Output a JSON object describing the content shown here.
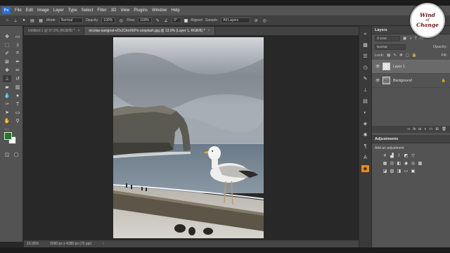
{
  "menubar": {
    "logo": "Ps",
    "items": [
      "File",
      "Edit",
      "Image",
      "Layer",
      "Type",
      "Select",
      "Filter",
      "3D",
      "View",
      "Plugins",
      "Window",
      "Help"
    ]
  },
  "options": {
    "mode_label": "Mode:",
    "mode_value": "Normal",
    "opacity_label": "Opacity:",
    "opacity_value": "100%",
    "flow_label": "Flow:",
    "flow_value": "100%",
    "angle_value": "0°",
    "aligned_label": "Aligned",
    "sample_label": "Sample:",
    "sample_value": "All Layers"
  },
  "tabs": [
    {
      "label": "Untitled-1 @ 97.6% (RGB/8) *",
      "close": "×"
    },
    {
      "label": "nicolas-savignat-vOxJCtmXKPo-unsplash.jpg @ 13.9% (Layer 1, RGB/8) *",
      "close": "×"
    }
  ],
  "status": {
    "zoom": "13.95%",
    "doc_size": "3280 px x 4380 px (72 ppi)"
  },
  "layers_panel": {
    "title": "Layers",
    "kind_label": "Kind",
    "blend_mode": "Normal",
    "opacity_label": "Opacity:",
    "lock_label": "Lock:",
    "fill_label": "Fill:",
    "layers": [
      {
        "name": "Layer 1",
        "selected": true
      },
      {
        "name": "Background",
        "selected": false,
        "locked": true
      }
    ],
    "footer_icons": [
      "link-icon",
      "fx-icon",
      "mask-icon",
      "adjustment-icon",
      "folder-icon",
      "new-layer-icon",
      "trash-icon"
    ]
  },
  "adjustments_panel": {
    "title": "Adjustments",
    "subtitle": "Add an adjustment"
  },
  "watermark": {
    "line1": "Wind",
    "line2": "of",
    "line3": "Change"
  },
  "colors": {
    "foreground": "#1e7a24",
    "background": "#ffffff",
    "accent": "#e38c1c"
  }
}
